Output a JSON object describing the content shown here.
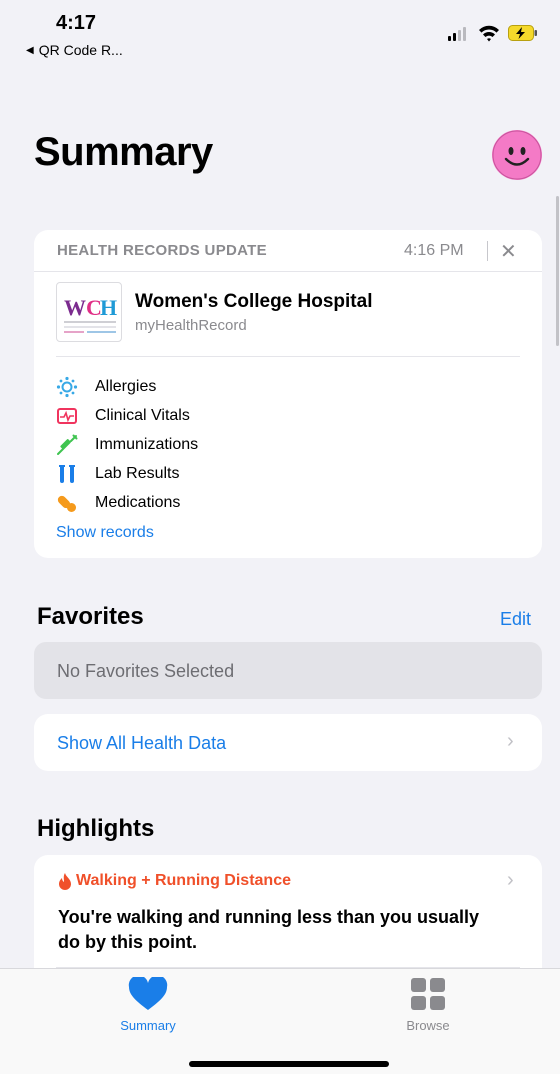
{
  "status_bar": {
    "time": "4:17",
    "back_app": "QR Code R..."
  },
  "page": {
    "title": "Summary"
  },
  "health_records": {
    "header": "HEALTH RECORDS UPDATE",
    "time": "4:16 PM",
    "close": "✕",
    "hospital_name": "Women's College Hospital",
    "hospital_sub": "myHealthRecord",
    "logo_text": "WCH",
    "records": [
      {
        "label": "Allergies",
        "icon": "allergies-icon",
        "color": "#38a9e6"
      },
      {
        "label": "Clinical Vitals",
        "icon": "clinical-vitals-icon",
        "color": "#f0345e"
      },
      {
        "label": "Immunizations",
        "icon": "immunizations-icon",
        "color": "#3fc450"
      },
      {
        "label": "Lab Results",
        "icon": "lab-results-icon",
        "color": "#1a7ee8"
      },
      {
        "label": "Medications",
        "icon": "medications-icon",
        "color": "#f59a1c"
      }
    ],
    "show_records": "Show records"
  },
  "favorites": {
    "title": "Favorites",
    "edit": "Edit",
    "empty": "No Favorites Selected",
    "show_all": "Show All Health Data"
  },
  "highlights": {
    "title": "Highlights",
    "metric": "Walking + Running Distance",
    "text": "You're walking and running less than you usually do by this point."
  },
  "tab_bar": {
    "summary": "Summary",
    "browse": "Browse"
  },
  "colors": {
    "accent": "#1a7ee8",
    "highlight_orange": "#f0502a",
    "avatar": "#f47ac6"
  }
}
